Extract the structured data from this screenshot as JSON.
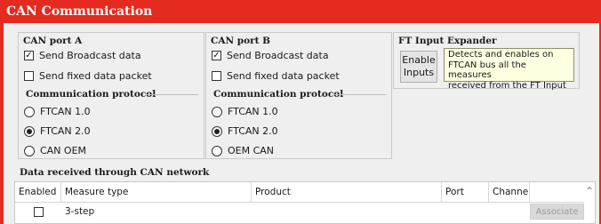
{
  "window": {
    "title": "CAN Communication"
  },
  "port_a": {
    "title": "CAN port A",
    "send_broadcast": {
      "label": "Send Broadcast data",
      "checked": true
    },
    "send_fixed": {
      "label": "Send fixed data packet",
      "checked": false
    },
    "protocol_title": "Communication protocol",
    "options": [
      {
        "label": "FTCAN 1.0",
        "selected": false
      },
      {
        "label": "FTCAN 2.0",
        "selected": true
      },
      {
        "label": "CAN OEM",
        "selected": false
      }
    ]
  },
  "port_b": {
    "title": "CAN port B",
    "send_broadcast": {
      "label": "Send Broadcast data",
      "checked": true
    },
    "send_fixed": {
      "label": "Send fixed data packet",
      "checked": false
    },
    "protocol_title": "Communication protocol",
    "options": [
      {
        "label": "FTCAN 1.0",
        "selected": false
      },
      {
        "label": "FTCAN 2.0",
        "selected": true
      },
      {
        "label": "OEM CAN",
        "selected": false
      }
    ]
  },
  "ft_expander": {
    "title": "FT Input Expander",
    "button_line1": "Enable",
    "button_line2": "Inputs",
    "tooltip_lines": [
      "Detects and enables on",
      "FTCAN bus all the measures",
      "received from the FT Input"
    ]
  },
  "data_received": {
    "title": "Data received through CAN network",
    "columns": [
      "Enabled",
      "Measure type",
      "Product",
      "Port",
      "Channel"
    ],
    "rows": [
      {
        "enabled": false,
        "measure": "3-step",
        "product": "",
        "port": "",
        "channel": "",
        "action": "Associate"
      }
    ]
  },
  "colors": {
    "title_bar": "#e52a1f",
    "tooltip_bg": "#ffffe1"
  }
}
